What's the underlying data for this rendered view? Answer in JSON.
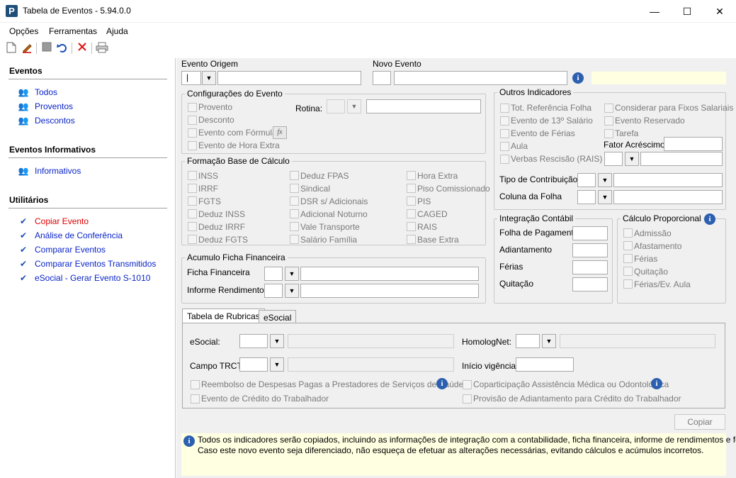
{
  "window": {
    "title": "Tabela de Eventos - 5.94.0.0",
    "app_icon_letter": "P",
    "minimize_glyph": "—",
    "maximize_glyph": "☐",
    "close_glyph": "✕"
  },
  "menu": {
    "opcoes": "Opções",
    "ferramentas": "Ferramentas",
    "ajuda": "Ajuda"
  },
  "toolbar": {
    "icons": [
      "new-document-icon",
      "edit-icon",
      "save-icon",
      "undo-icon",
      "delete-icon",
      "print-icon"
    ]
  },
  "sidebar": {
    "eventos_header": "Eventos",
    "eventos_items": [
      "Todos",
      "Proventos",
      "Descontos"
    ],
    "informativos_header": "Eventos Informativos",
    "informativos_items": [
      "Informativos"
    ],
    "utilitarios_header": "Utilitários",
    "utilitarios_items": [
      "Copiar Evento",
      "Análise de Conferência",
      "Comparar Eventos",
      "Comparar Eventos Transmitidos",
      "eSocial - Gerar Evento S-1010"
    ]
  },
  "evento_origem": {
    "label": "Evento Origem",
    "code_value": "|",
    "name_value": ""
  },
  "novo_evento": {
    "label": "Novo Evento",
    "code_value": "",
    "name_value": ""
  },
  "configuracoes": {
    "title": "Configurações do Evento",
    "provento": "Provento",
    "desconto": "Desconto",
    "evento_formula": "Evento com Fórmula",
    "fx_label": "fx",
    "hora_extra": "Evento de Hora Extra",
    "rotina_label": "Rotina:"
  },
  "formacao": {
    "title": "Formação Base de Cálculo",
    "col1": [
      "INSS",
      "IRRF",
      "FGTS",
      "Deduz INSS",
      "Deduz IRRF",
      "Deduz FGTS"
    ],
    "col2": [
      "Deduz FPAS",
      "Sindical",
      "DSR s/ Adicionais",
      "Adicional Noturno",
      "Vale Transporte",
      "Salário Família"
    ],
    "col3": [
      "Hora Extra",
      "Piso Comissionado",
      "PIS",
      "CAGED",
      "RAIS",
      "Base Extra"
    ]
  },
  "acumulo": {
    "title": "Acumulo Ficha Financeira",
    "ficha_label": "Ficha Financeira",
    "informe_label": "Informe Rendimentos"
  },
  "outros": {
    "title": "Outros Indicadores",
    "left": [
      "Tot. Referência Folha",
      "Evento de 13º Salário",
      "Evento de Férias",
      "Aula",
      "Verbas Rescisão (RAIS)"
    ],
    "right": [
      "Considerar para Fixos Salariais",
      "Evento Reservado",
      "Tarefa"
    ],
    "fator_label": "Fator Acréscimo",
    "tipo_contribuicao": "Tipo de Contribuição",
    "coluna_folha": "Coluna da Folha"
  },
  "integracao": {
    "title": "Integração Contábil",
    "rows": [
      "Folha de Pagamento",
      "Adiantamento",
      "Férias",
      "Quitação"
    ]
  },
  "proporcional": {
    "title": "Cálculo Proporcional",
    "items": [
      "Admissão",
      "Afastamento",
      "Férias",
      "Quitação",
      "Férias/Ev. Aula"
    ]
  },
  "tabs": {
    "rubricas": "Tabela de Rubricas",
    "esocial": "eSocial",
    "esocial_label": "eSocial:",
    "homolognet_label": "HomologNet:",
    "campo_trct_label": "Campo TRCT:",
    "inicio_vigencia_label": "Início vigência:",
    "reembolso": "Reembolso de Despesas Pagas a Prestadores de Serviços de Saúde",
    "coparticipacao": "Coparticipação Assistência Médica ou Odontológica",
    "credito_trabalhador": "Evento de Crédito do Trabalhador",
    "provisao": "Provisão de Adiantamento para Crédito do Trabalhador"
  },
  "copiar_button": "Copiar",
  "note": {
    "line1": "Todos os indicadores serão copiados, incluindo as informações de integração com a contabilidade, ficha financeira, informe de rendimentos e fórmula.",
    "line2": "Caso este novo evento seja diferenciado, não esqueça de efetuar as alterações necessárias, evitando cálculos e acúmulos incorretos."
  },
  "colors": {
    "link": "#0a24c8",
    "active_link": "#e00000",
    "info_yellow": "#ffffe1",
    "panel_bg": "#f0f0f0"
  }
}
